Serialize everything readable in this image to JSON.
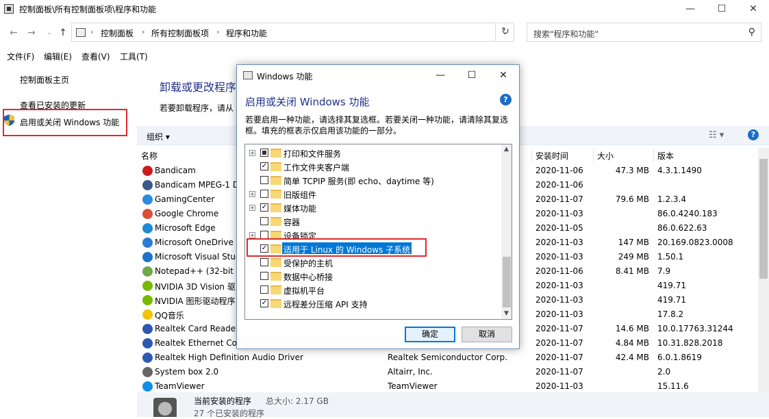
{
  "window": {
    "title": "控制面板\\所有控制面板项\\程序和功能",
    "controls": {
      "minimize": "—",
      "maximize": "☐",
      "close": "✕"
    }
  },
  "address": {
    "crumbs": [
      "控制面板",
      "所有控制面板项",
      "程序和功能"
    ],
    "search_placeholder": "搜索\"程序和功能\""
  },
  "menu": [
    "文件(F)",
    "编辑(E)",
    "查看(V)",
    "工具(T)"
  ],
  "sidebar": {
    "items": [
      "控制面板主页",
      "查看已安装的更新",
      "启用或关闭 Windows 功能"
    ]
  },
  "main": {
    "title": "卸载或更改程序",
    "subtitle": "若要卸载程序，请从"
  },
  "toolbar": {
    "organize": "组织 ▾"
  },
  "columns": [
    "名称",
    "安装时间",
    "大小",
    "版本"
  ],
  "programs": [
    {
      "name": "Bandicam",
      "publisher": "",
      "date": "2020-11-06",
      "size": "47.3 MB",
      "version": "4.3.1.1490",
      "icon": "bandicam-icon",
      "color": "#cc1b1b"
    },
    {
      "name": "Bandicam MPEG-1 D",
      "publisher": "",
      "date": "2020-11-06",
      "size": "",
      "version": "",
      "icon": "installer-icon",
      "color": "#3a5a8c"
    },
    {
      "name": "GamingCenter",
      "publisher": "",
      "date": "2020-11-07",
      "size": "79.6 MB",
      "version": "1.2.3.4",
      "icon": "gamingcenter-icon",
      "color": "#2b8be0"
    },
    {
      "name": "Google Chrome",
      "publisher": "",
      "date": "2020-11-03",
      "size": "",
      "version": "86.0.4240.183",
      "icon": "chrome-icon",
      "color": "#dd4b39"
    },
    {
      "name": "Microsoft Edge",
      "publisher": "",
      "date": "2020-11-05",
      "size": "",
      "version": "86.0.622.63",
      "icon": "edge-icon",
      "color": "#1f8ad6"
    },
    {
      "name": "Microsoft OneDrive",
      "publisher": "",
      "date": "2020-11-03",
      "size": "147 MB",
      "version": "20.169.0823.0008",
      "icon": "onedrive-icon",
      "color": "#2b7cd3"
    },
    {
      "name": "Microsoft Visual Stud",
      "publisher": "",
      "date": "2020-11-03",
      "size": "249 MB",
      "version": "1.50.1",
      "icon": "vscode-icon",
      "color": "#1b74c9"
    },
    {
      "name": "Notepad++ (32-bit x",
      "publisher": "",
      "date": "2020-11-06",
      "size": "8.41 MB",
      "version": "7.9",
      "icon": "notepadpp-icon",
      "color": "#6fa846"
    },
    {
      "name": "NVIDIA 3D Vision 驱",
      "publisher": "",
      "date": "2020-11-03",
      "size": "",
      "version": "419.71",
      "icon": "nvidia-icon",
      "color": "#76b900"
    },
    {
      "name": "NVIDIA 图形驱动程序",
      "publisher": "",
      "date": "2020-11-03",
      "size": "",
      "version": "419.71",
      "icon": "nvidia-icon",
      "color": "#76b900"
    },
    {
      "name": "QQ音乐",
      "publisher": "",
      "date": "2020-11-03",
      "size": "",
      "version": "17.8.2",
      "icon": "qqmusic-icon",
      "color": "#f5c400"
    },
    {
      "name": "Realtek Card Reader",
      "publisher": "",
      "date": "2020-11-07",
      "size": "14.6 MB",
      "version": "10.0.17763.31244",
      "icon": "realtek-icon",
      "color": "#2f58b3"
    },
    {
      "name": "Realtek Ethernet Cor",
      "publisher": "",
      "date": "2020-11-07",
      "size": "4.84 MB",
      "version": "10.31.828.2018",
      "icon": "realtek-icon",
      "color": "#2f58b3"
    },
    {
      "name": "Realtek High Definition Audio Driver",
      "publisher": "Realtek Semiconductor Corp.",
      "date": "2020-11-07",
      "size": "42.4 MB",
      "version": "6.0.1.8619",
      "icon": "realtek-icon",
      "color": "#2f58b3"
    },
    {
      "name": "System box 2.0",
      "publisher": "Altairr, Inc.",
      "date": "2020-11-07",
      "size": "",
      "version": "2.0",
      "icon": "gear-icon",
      "color": "#666666"
    },
    {
      "name": "TeamViewer",
      "publisher": "TeamViewer",
      "date": "2020-11-03",
      "size": "",
      "version": "15.11.6",
      "icon": "teamviewer-icon",
      "color": "#0e8ee9"
    }
  ],
  "status": {
    "title": "当前安装的程序",
    "size": "总大小:  2.17 GB",
    "count": "27 个已安装的程序"
  },
  "dialog": {
    "title": "Windows 功能",
    "heading": "启用或关闭 Windows 功能",
    "help": "?",
    "description": "若要启用一种功能，请选择其复选框。若要关闭一种功能，请清除其复选框。填充的框表示仅启用该功能的一部分。",
    "features": [
      {
        "label": "打印和文件服务",
        "expand": true,
        "state": "partial"
      },
      {
        "label": "工作文件夹客户端",
        "expand": false,
        "state": "checked"
      },
      {
        "label": "简单 TCPIP 服务(即 echo、daytime 等)",
        "expand": false,
        "state": "unchecked"
      },
      {
        "label": "旧版组件",
        "expand": true,
        "state": "unchecked"
      },
      {
        "label": "媒体功能",
        "expand": true,
        "state": "checked"
      },
      {
        "label": "容器",
        "expand": false,
        "state": "unchecked"
      },
      {
        "label": "设备锁定",
        "expand": true,
        "state": "unchecked"
      },
      {
        "label": "适用于 Linux 的 Windows 子系统",
        "expand": false,
        "state": "checked",
        "selected": true
      },
      {
        "label": "受保护的主机",
        "expand": false,
        "state": "unchecked"
      },
      {
        "label": "数据中心桥接",
        "expand": false,
        "state": "unchecked"
      },
      {
        "label": "虚拟机平台",
        "expand": false,
        "state": "unchecked"
      },
      {
        "label": "远程差分压缩 API 支持",
        "expand": false,
        "state": "checked"
      }
    ],
    "ok": "确定",
    "cancel": "取消"
  }
}
